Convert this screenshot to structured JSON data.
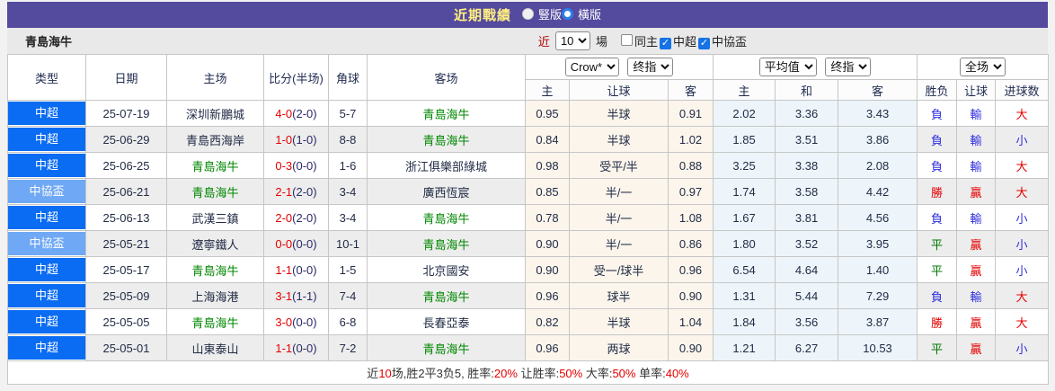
{
  "colors": {
    "accent_purple": "#544a9e",
    "title_yellow": "#ffef80",
    "csl_badge_blue": "#0a6cf2",
    "cup_badge_blue": "#6fa8f5",
    "team_green": "#008800",
    "win_red": "#e60000",
    "loss_blue": "#2d2de0",
    "draw_green": "#007700",
    "asian_cell_bg": "#fbf5ec",
    "euro_cell_bg": "#edf5fa"
  },
  "title_bar": {
    "title": "近期戰績",
    "layout_options": [
      {
        "label": "豎版",
        "selected": false
      },
      {
        "label": "橫版",
        "selected": true
      }
    ]
  },
  "controls": {
    "team_name": "青島海牛",
    "recent_label_prefix": "近",
    "recent_count": "10",
    "recent_label_suffix": "場",
    "filters": [
      {
        "label": "同主",
        "checked": false
      },
      {
        "label": "中超",
        "checked": true
      },
      {
        "label": "中協盃",
        "checked": true
      }
    ]
  },
  "table": {
    "columns": {
      "type": "类型",
      "date": "日期",
      "home": "主场",
      "score": "比分(半场)",
      "corner": "角球",
      "away": "客场"
    },
    "selects": {
      "asian_company": "Crow*",
      "asian_stage": "终指",
      "euro_company": "平均值",
      "euro_stage": "终指",
      "scope": "全场"
    },
    "subheaders": {
      "asian": [
        "主",
        "让球",
        "客"
      ],
      "euro": [
        "主",
        "和",
        "客"
      ],
      "result": [
        "胜负",
        "让球",
        "进球数"
      ]
    },
    "matches": [
      {
        "type": "中超",
        "is_cup": false,
        "date": "25-07-19",
        "home": "深圳新鵬城",
        "home_is_team": false,
        "score": "4-0",
        "half": "(2-0)",
        "corner": "5-7",
        "away": "青島海牛",
        "away_is_team": true,
        "asian": [
          "0.95",
          "半球",
          "0.91"
        ],
        "euro": [
          "2.02",
          "3.36",
          "3.43"
        ],
        "result": [
          {
            "t": "負",
            "c": "blue"
          },
          {
            "t": "輸",
            "c": "blue"
          },
          {
            "t": "大",
            "c": "red"
          }
        ]
      },
      {
        "type": "中超",
        "is_cup": false,
        "date": "25-06-29",
        "home": "青島西海岸",
        "home_is_team": false,
        "score": "1-0",
        "half": "(1-0)",
        "corner": "8-8",
        "away": "青島海牛",
        "away_is_team": true,
        "asian": [
          "0.84",
          "半球",
          "1.02"
        ],
        "euro": [
          "1.85",
          "3.51",
          "3.86"
        ],
        "result": [
          {
            "t": "負",
            "c": "blue"
          },
          {
            "t": "輸",
            "c": "blue"
          },
          {
            "t": "小",
            "c": "blue"
          }
        ]
      },
      {
        "type": "中超",
        "is_cup": false,
        "date": "25-06-25",
        "home": "青島海牛",
        "home_is_team": true,
        "score": "0-3",
        "half": "(0-0)",
        "corner": "1-6",
        "away": "浙江俱樂部綠城",
        "away_is_team": false,
        "asian": [
          "0.98",
          "受平/半",
          "0.88"
        ],
        "euro": [
          "3.25",
          "3.38",
          "2.08"
        ],
        "result": [
          {
            "t": "負",
            "c": "blue"
          },
          {
            "t": "輸",
            "c": "blue"
          },
          {
            "t": "大",
            "c": "red"
          }
        ]
      },
      {
        "type": "中協盃",
        "is_cup": true,
        "date": "25-06-21",
        "home": "青島海牛",
        "home_is_team": true,
        "score": "2-1",
        "half": "(2-0)",
        "corner": "3-4",
        "away": "廣西恆宸",
        "away_is_team": false,
        "asian": [
          "0.85",
          "半/一",
          "0.97"
        ],
        "euro": [
          "1.74",
          "3.58",
          "4.42"
        ],
        "result": [
          {
            "t": "勝",
            "c": "red"
          },
          {
            "t": "贏",
            "c": "red"
          },
          {
            "t": "大",
            "c": "red"
          }
        ]
      },
      {
        "type": "中超",
        "is_cup": false,
        "date": "25-06-13",
        "home": "武漢三鎮",
        "home_is_team": false,
        "score": "2-0",
        "half": "(2-0)",
        "corner": "3-4",
        "away": "青島海牛",
        "away_is_team": true,
        "asian": [
          "0.78",
          "半/一",
          "1.08"
        ],
        "euro": [
          "1.67",
          "3.81",
          "4.56"
        ],
        "result": [
          {
            "t": "負",
            "c": "blue"
          },
          {
            "t": "輸",
            "c": "blue"
          },
          {
            "t": "小",
            "c": "blue"
          }
        ]
      },
      {
        "type": "中協盃",
        "is_cup": true,
        "date": "25-05-21",
        "home": "遼寧鐵人",
        "home_is_team": false,
        "score": "0-0",
        "half": "(0-0)",
        "corner": "10-1",
        "away": "青島海牛",
        "away_is_team": true,
        "asian": [
          "0.90",
          "半/一",
          "0.86"
        ],
        "euro": [
          "1.80",
          "3.52",
          "3.95"
        ],
        "result": [
          {
            "t": "平",
            "c": "green"
          },
          {
            "t": "贏",
            "c": "red"
          },
          {
            "t": "小",
            "c": "blue"
          }
        ]
      },
      {
        "type": "中超",
        "is_cup": false,
        "date": "25-05-17",
        "home": "青島海牛",
        "home_is_team": true,
        "score": "1-1",
        "half": "(0-0)",
        "corner": "1-5",
        "away": "北京國安",
        "away_is_team": false,
        "asian": [
          "0.90",
          "受一/球半",
          "0.96"
        ],
        "euro": [
          "6.54",
          "4.64",
          "1.40"
        ],
        "result": [
          {
            "t": "平",
            "c": "green"
          },
          {
            "t": "贏",
            "c": "red"
          },
          {
            "t": "小",
            "c": "blue"
          }
        ]
      },
      {
        "type": "中超",
        "is_cup": false,
        "date": "25-05-09",
        "home": "上海海港",
        "home_is_team": false,
        "score": "3-1",
        "half": "(1-1)",
        "corner": "7-4",
        "away": "青島海牛",
        "away_is_team": true,
        "asian": [
          "0.96",
          "球半",
          "0.90"
        ],
        "euro": [
          "1.31",
          "5.44",
          "7.29"
        ],
        "result": [
          {
            "t": "負",
            "c": "blue"
          },
          {
            "t": "輸",
            "c": "blue"
          },
          {
            "t": "大",
            "c": "red"
          }
        ]
      },
      {
        "type": "中超",
        "is_cup": false,
        "date": "25-05-05",
        "home": "青島海牛",
        "home_is_team": true,
        "score": "3-0",
        "half": "(0-0)",
        "corner": "6-8",
        "away": "長春亞泰",
        "away_is_team": false,
        "asian": [
          "0.82",
          "半球",
          "1.04"
        ],
        "euro": [
          "1.84",
          "3.56",
          "3.87"
        ],
        "result": [
          {
            "t": "勝",
            "c": "red"
          },
          {
            "t": "贏",
            "c": "red"
          },
          {
            "t": "大",
            "c": "red"
          }
        ]
      },
      {
        "type": "中超",
        "is_cup": false,
        "date": "25-05-01",
        "home": "山東泰山",
        "home_is_team": false,
        "score": "1-1",
        "half": "(0-0)",
        "corner": "7-2",
        "away": "青島海牛",
        "away_is_team": true,
        "asian": [
          "0.96",
          "两球",
          "0.90"
        ],
        "euro": [
          "1.21",
          "6.27",
          "10.53"
        ],
        "result": [
          {
            "t": "平",
            "c": "green"
          },
          {
            "t": "贏",
            "c": "red"
          },
          {
            "t": "小",
            "c": "blue"
          }
        ]
      }
    ]
  },
  "footer": {
    "segments": [
      {
        "text": "近",
        "red": false
      },
      {
        "text": "10",
        "red": true
      },
      {
        "text": "场,胜2平3负5, 胜率:",
        "red": false
      },
      {
        "text": "20%",
        "red": true
      },
      {
        "text": " 让胜率:",
        "red": false
      },
      {
        "text": "50%",
        "red": true
      },
      {
        "text": " 大率:",
        "red": false
      },
      {
        "text": "50%",
        "red": true
      },
      {
        "text": " 单率:",
        "red": false
      },
      {
        "text": "40%",
        "red": true
      }
    ]
  }
}
